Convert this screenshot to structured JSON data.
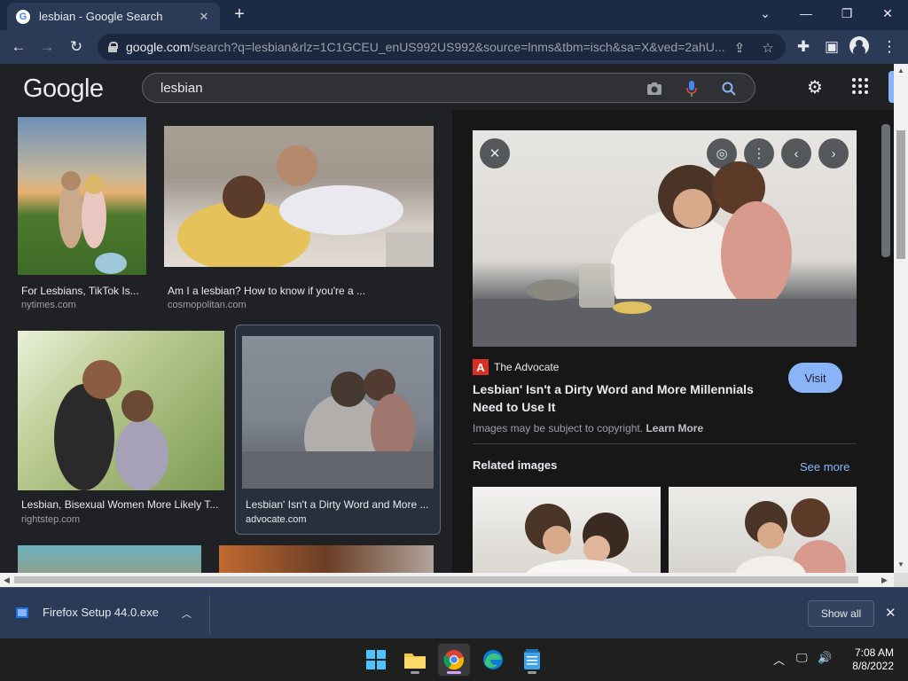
{
  "browser": {
    "tab_title": "lesbian - Google Search",
    "tab_favicon_letter": "G",
    "url_host": "google.com",
    "url_rest": "/search?q=lesbian&rlz=1C1GCEU_enUS992US992&source=lnms&tbm=isch&sa=X&ved=2ahU..."
  },
  "header": {
    "logo": "Google",
    "query": "lesbian"
  },
  "results": [
    {
      "title": "For Lesbians, TikTok Is...",
      "source": "nytimes.com"
    },
    {
      "title": "Am I a lesbian? How to know if you're a ...",
      "source": "cosmopolitan.com"
    },
    {
      "title": "Lesbian, Bisexual Women More Likely T...",
      "source": "rightstep.com"
    },
    {
      "title": "Lesbian' Isn't a Dirty Word and More ...",
      "source": "advocate.com"
    }
  ],
  "preview": {
    "site_favicon_letter": "A",
    "site_name": "The Advocate",
    "title": "Lesbian' Isn't a Dirty Word and More Millennials Need to Use It",
    "visit_label": "Visit",
    "copyright_text": "Images may be subject to copyright.",
    "learn_more": "Learn More",
    "related_label": "Related images",
    "see_more": "See more"
  },
  "downloads": {
    "file_name": "Firefox Setup 44.0.exe",
    "show_all": "Show all"
  },
  "taskbar": {
    "time": "7:08 AM",
    "date": "8/8/2022"
  },
  "colors": {
    "accent_blue": "#8ab4f8",
    "page_bg": "#202124",
    "chrome_frame": "#1b2a45",
    "advocate_red": "#d93025"
  }
}
